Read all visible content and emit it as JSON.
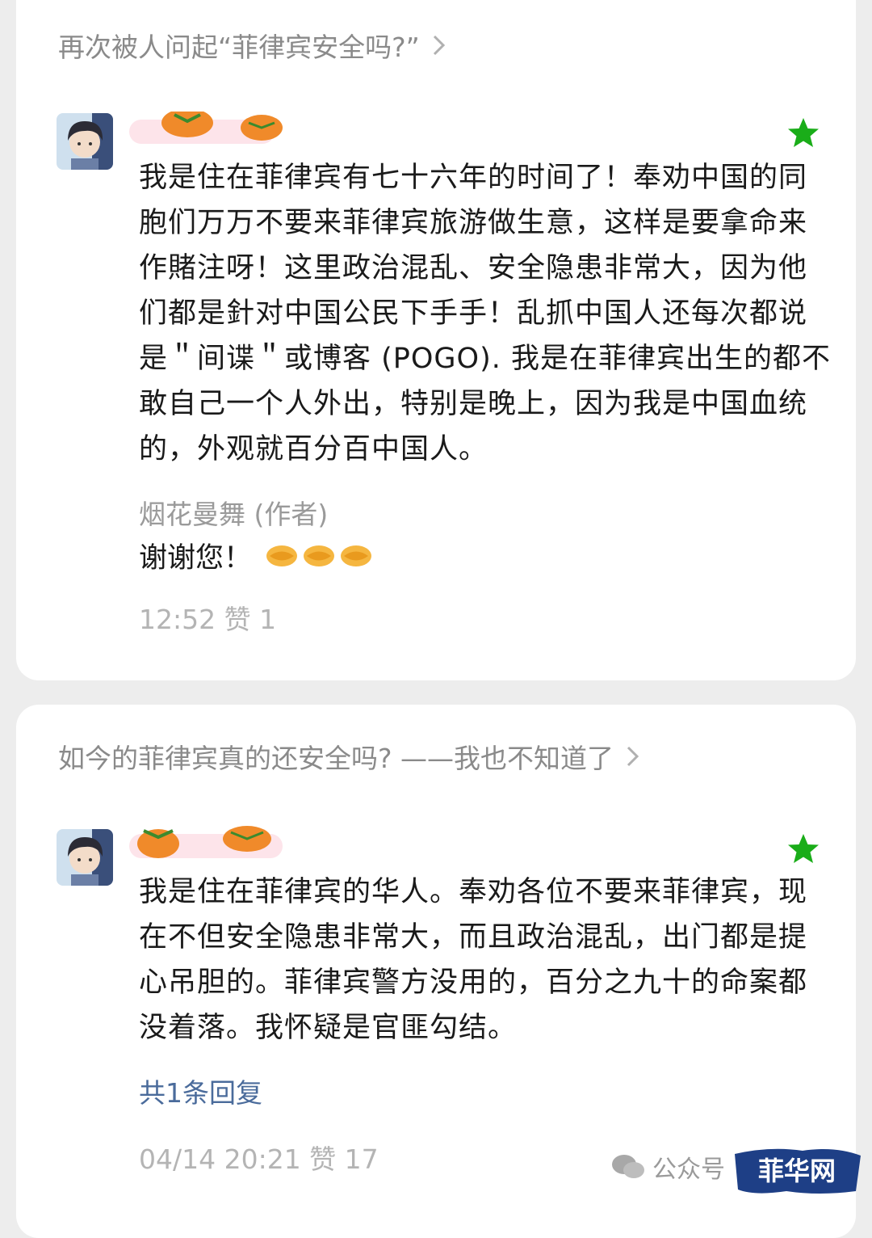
{
  "comments": [
    {
      "article_title": "再次被人问起“菲律宾安全吗?”",
      "text": "我是住在菲律宾有七十六年的时间了！奉劝中国的同胞们万万不要来菲律宾旅游做生意，这样是要拿命来作賭注呀！这里政治混乱、安全隐患非常大，因为他们都是針对中国公民下手手！乱抓中国人还每次都说是＂间谍＂或博客 (POGO). 我是在菲律宾出生的都不敢自己一个人外出，特别是晚上，因为我是中国血统的，外观就百分百中国人。",
      "author_reply_label": "烟花曼舞 (作者)",
      "author_reply_text": "谢谢您！",
      "meta": "12:52 赞 1"
    },
    {
      "article_title": "如今的菲律宾真的还安全吗? ——我也不知道了",
      "text": "我是住在菲律宾的华人。奉劝各位不要来菲律宾，现在不但安全隐患非常大，而且政治混乱，出门都是提心吊胆的。菲律宾警方没用的，百分之九十的命案都没着落。我怀疑是官匪勾结。",
      "reply_count": "共1条回复",
      "meta": "04/14 20:21 赞 17"
    }
  ],
  "watermark": {
    "label": "公众号",
    "logo_text": "菲华网"
  },
  "colors": {
    "star": "#1aad19",
    "reply_link": "#4a6b9b",
    "meta": "#b4b4b4",
    "logo_bg": "#1e3f86"
  }
}
